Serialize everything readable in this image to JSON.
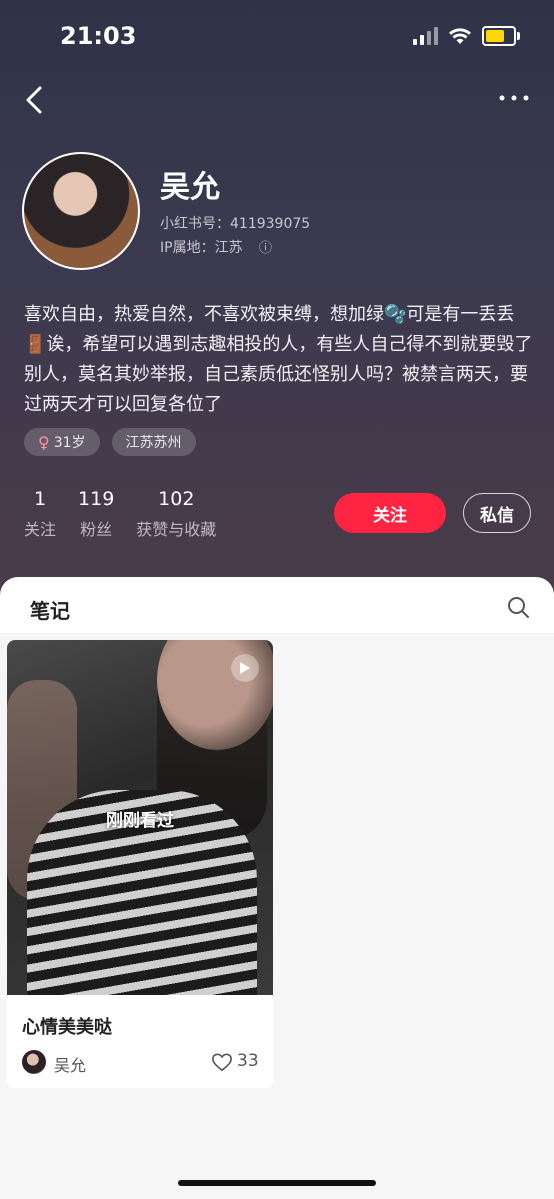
{
  "status_bar": {
    "time": "21:03"
  },
  "profile": {
    "name": "吴允",
    "red_id": "小红书号：411939075",
    "ip_location": "IP属地：江苏",
    "bio": "喜欢自由，热爱自然，不喜欢被束缚，想加绿🫧可是有一丢丢🚪诶，希望可以遇到志趣相投的人，有些人自己得不到就要毁了别人，莫名其妙举报，自己素质低还怪别人吗？被禁言两天，要过两天才可以回复各位了",
    "tags": {
      "age": "31岁",
      "location": "江苏苏州"
    },
    "stats": [
      {
        "value": "1",
        "label": "关注"
      },
      {
        "value": "119",
        "label": "粉丝"
      },
      {
        "value": "102",
        "label": "获赞与收藏"
      }
    ],
    "follow_label": "关注",
    "message_label": "私信"
  },
  "tabs": {
    "notes": "笔记"
  },
  "notes": [
    {
      "overlay": "刚刚看过",
      "title": "心情美美哒",
      "author": "吴允",
      "likes": "33"
    }
  ],
  "colors": {
    "accent": "#ff2442",
    "header_bg": "#3c3a4f"
  }
}
